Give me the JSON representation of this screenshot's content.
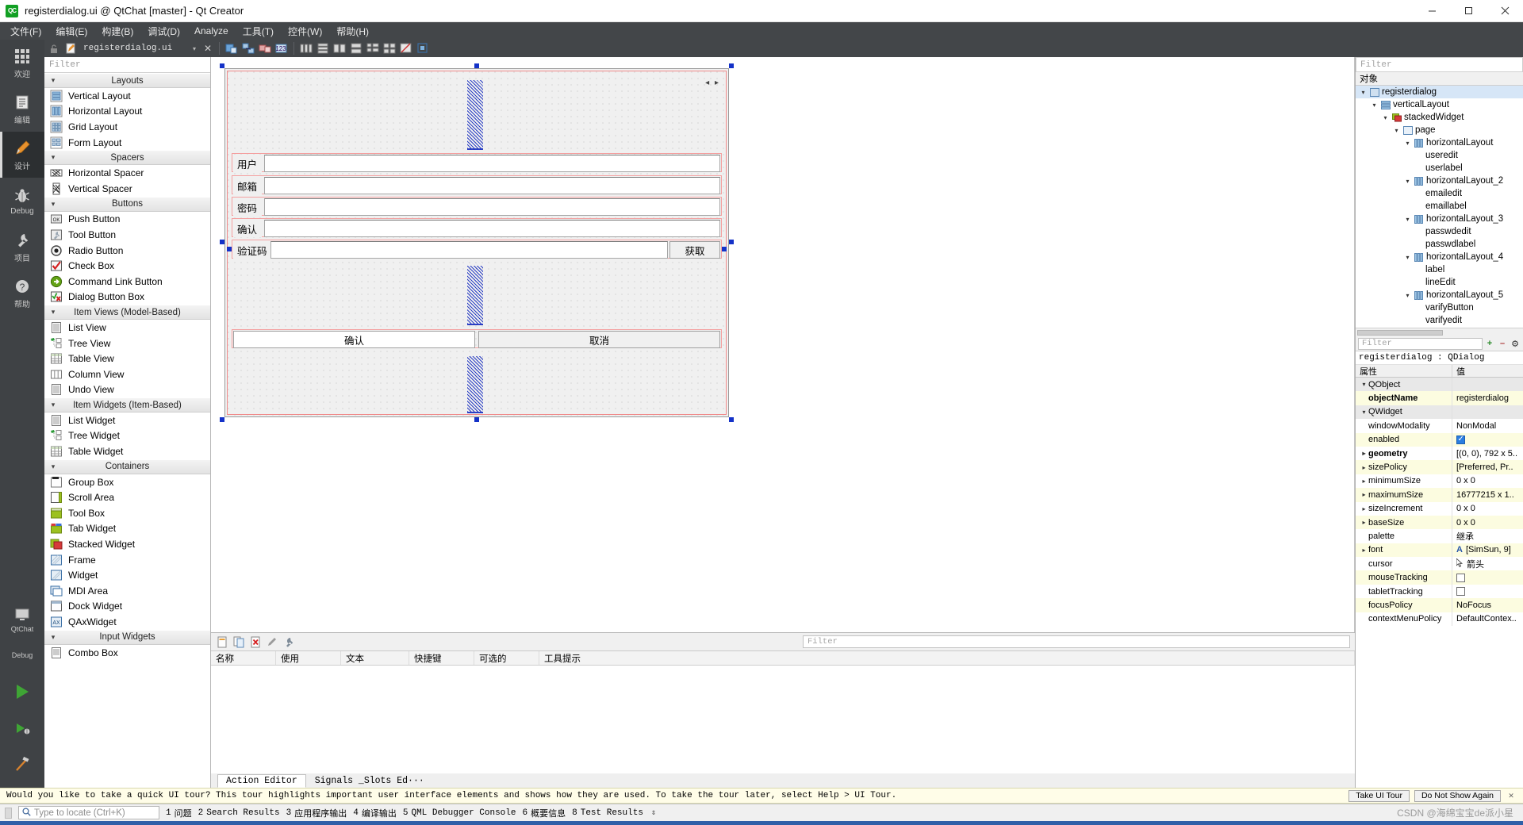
{
  "window": {
    "title": "registerdialog.ui @ QtChat [master] - Qt Creator",
    "app_badge": "QC",
    "minimize": "–",
    "maximize": "□",
    "close": "✕"
  },
  "menubar": [
    {
      "label": "文件(F)",
      "mnemonic": "F"
    },
    {
      "label": "编辑(E)",
      "mnemonic": "E"
    },
    {
      "label": "构建(B)",
      "mnemonic": "B"
    },
    {
      "label": "调试(D)",
      "mnemonic": "D"
    },
    {
      "label": "Analyze",
      "mnemonic": "A"
    },
    {
      "label": "工具(T)",
      "mnemonic": "T"
    },
    {
      "label": "控件(W)",
      "mnemonic": "W"
    },
    {
      "label": "帮助(H)",
      "mnemonic": "H"
    }
  ],
  "modebar": {
    "items": [
      {
        "label": "欢迎",
        "icon": "grid-icon",
        "active": false
      },
      {
        "label": "编辑",
        "icon": "document-icon",
        "active": false
      },
      {
        "label": "设计",
        "icon": "pencil-icon",
        "active": true
      },
      {
        "label": "Debug",
        "icon": "bug-icon",
        "active": false
      },
      {
        "label": "项目",
        "icon": "wrench-icon",
        "active": false
      },
      {
        "label": "帮助",
        "icon": "question-icon",
        "active": false
      }
    ],
    "bottom": [
      {
        "label": "QtChat",
        "icon": "monitor-icon"
      },
      {
        "label": "Debug",
        "icon": "monitor-icon"
      },
      {
        "label": "",
        "icon": "run-icon"
      },
      {
        "label": "",
        "icon": "debug-run-icon"
      },
      {
        "label": "",
        "icon": "build-hammer-icon"
      }
    ]
  },
  "editor_toolbar": {
    "file_name": "registerdialog.ui",
    "caret": "▾",
    "close": "✕",
    "tools": [
      "edit-widgets-icon",
      "edit-signals-icon",
      "edit-buddies-icon",
      "edit-tab-order-icon",
      "layout-horizontal-icon",
      "layout-vertical-icon",
      "layout-splitter-h-icon",
      "layout-splitter-v-icon",
      "layout-form-icon",
      "layout-grid-icon",
      "break-layout-icon",
      "adjust-size-icon"
    ]
  },
  "widget_box": {
    "filter_placeholder": "Filter",
    "groups": [
      {
        "name": "Layouts",
        "items": [
          {
            "label": "Vertical Layout",
            "icon": "vertical-layout-icon"
          },
          {
            "label": "Horizontal Layout",
            "icon": "horizontal-layout-icon"
          },
          {
            "label": "Grid Layout",
            "icon": "grid-layout-icon"
          },
          {
            "label": "Form Layout",
            "icon": "form-layout-icon"
          }
        ]
      },
      {
        "name": "Spacers",
        "items": [
          {
            "label": "Horizontal Spacer",
            "icon": "horizontal-spacer-icon"
          },
          {
            "label": "Vertical Spacer",
            "icon": "vertical-spacer-icon"
          }
        ]
      },
      {
        "name": "Buttons",
        "items": [
          {
            "label": "Push Button",
            "icon": "push-button-icon"
          },
          {
            "label": "Tool Button",
            "icon": "tool-button-icon"
          },
          {
            "label": "Radio Button",
            "icon": "radio-button-icon"
          },
          {
            "label": "Check Box",
            "icon": "check-box-icon"
          },
          {
            "label": "Command Link Button",
            "icon": "command-link-icon"
          },
          {
            "label": "Dialog Button Box",
            "icon": "dialog-button-box-icon"
          }
        ]
      },
      {
        "name": "Item Views (Model-Based)",
        "items": [
          {
            "label": "List View",
            "icon": "list-view-icon"
          },
          {
            "label": "Tree View",
            "icon": "tree-view-icon"
          },
          {
            "label": "Table View",
            "icon": "table-view-icon"
          },
          {
            "label": "Column View",
            "icon": "column-view-icon"
          },
          {
            "label": "Undo View",
            "icon": "undo-view-icon"
          }
        ]
      },
      {
        "name": "Item Widgets (Item-Based)",
        "items": [
          {
            "label": "List Widget",
            "icon": "list-widget-icon"
          },
          {
            "label": "Tree Widget",
            "icon": "tree-widget-icon"
          },
          {
            "label": "Table Widget",
            "icon": "table-widget-icon"
          }
        ]
      },
      {
        "name": "Containers",
        "items": [
          {
            "label": "Group Box",
            "icon": "group-box-icon"
          },
          {
            "label": "Scroll Area",
            "icon": "scroll-area-icon"
          },
          {
            "label": "Tool Box",
            "icon": "tool-box-icon"
          },
          {
            "label": "Tab Widget",
            "icon": "tab-widget-icon"
          },
          {
            "label": "Stacked Widget",
            "icon": "stacked-widget-icon"
          },
          {
            "label": "Frame",
            "icon": "frame-icon"
          },
          {
            "label": "Widget",
            "icon": "widget-icon"
          },
          {
            "label": "MDI Area",
            "icon": "mdi-area-icon"
          },
          {
            "label": "Dock Widget",
            "icon": "dock-widget-icon"
          },
          {
            "label": "QAxWidget",
            "icon": "qax-widget-icon"
          }
        ]
      },
      {
        "name": "Input Widgets",
        "items": [
          {
            "label": "Combo Box",
            "icon": "combo-box-icon"
          }
        ]
      }
    ]
  },
  "designer": {
    "form_rows": [
      {
        "label": "用户",
        "widget": "lineedit"
      },
      {
        "label": "邮箱",
        "widget": "lineedit"
      },
      {
        "label": "密码",
        "widget": "lineedit"
      },
      {
        "label": "确认",
        "widget": "lineedit"
      },
      {
        "label": "验证码",
        "widget": "lineedit",
        "button": "获取"
      }
    ],
    "buttons": [
      {
        "label": "确认"
      },
      {
        "label": "取消"
      }
    ],
    "nav_arrows": "◂ ▸"
  },
  "object_inspector": {
    "filter_placeholder": "Filter",
    "column_header": "对象",
    "rows": [
      {
        "label": "registerdialog",
        "depth": 0,
        "caret": "▾",
        "icon": "widget-icon",
        "selected": true
      },
      {
        "label": "verticalLayout",
        "depth": 1,
        "caret": "▾",
        "icon": "layout-icon",
        "selected": false
      },
      {
        "label": "stackedWidget",
        "depth": 2,
        "caret": "▾",
        "icon": "stacked-icon",
        "selected": false
      },
      {
        "label": "page",
        "depth": 3,
        "caret": "▾",
        "icon": "page-icon",
        "selected": false
      },
      {
        "label": "horizontalLayout",
        "depth": 4,
        "caret": "▾",
        "icon": "layout-icon",
        "selected": false
      },
      {
        "label": "useredit",
        "depth": 5,
        "caret": "",
        "icon": "lineedit-icon",
        "selected": false
      },
      {
        "label": "userlabel",
        "depth": 5,
        "caret": "",
        "icon": "label-icon",
        "selected": false
      },
      {
        "label": "horizontalLayout_2",
        "depth": 4,
        "caret": "▾",
        "icon": "layout-icon",
        "selected": false
      },
      {
        "label": "emailedit",
        "depth": 5,
        "caret": "",
        "icon": "lineedit-icon",
        "selected": false
      },
      {
        "label": "emaillabel",
        "depth": 5,
        "caret": "",
        "icon": "label-icon",
        "selected": false
      },
      {
        "label": "horizontalLayout_3",
        "depth": 4,
        "caret": "▾",
        "icon": "layout-icon",
        "selected": false
      },
      {
        "label": "passwdedit",
        "depth": 5,
        "caret": "",
        "icon": "lineedit-icon",
        "selected": false
      },
      {
        "label": "passwdlabel",
        "depth": 5,
        "caret": "",
        "icon": "label-icon",
        "selected": false
      },
      {
        "label": "horizontalLayout_4",
        "depth": 4,
        "caret": "▾",
        "icon": "layout-icon",
        "selected": false
      },
      {
        "label": "label",
        "depth": 5,
        "caret": "",
        "icon": "label-icon",
        "selected": false
      },
      {
        "label": "lineEdit",
        "depth": 5,
        "caret": "",
        "icon": "lineedit-icon",
        "selected": false
      },
      {
        "label": "horizontalLayout_5",
        "depth": 4,
        "caret": "▾",
        "icon": "layout-icon",
        "selected": false
      },
      {
        "label": "varifyButton",
        "depth": 5,
        "caret": "",
        "icon": "button-icon",
        "selected": false
      },
      {
        "label": "varifyedit",
        "depth": 5,
        "caret": "",
        "icon": "lineedit-icon",
        "selected": false
      }
    ]
  },
  "property_editor": {
    "filter_placeholder": "Filter",
    "add_btn": "+",
    "remove_btn": "–",
    "config_btn": "⚙",
    "object_line": "registerdialog : QDialog",
    "headers": {
      "name": "属性",
      "value": "值"
    },
    "rows": [
      {
        "name": "QObject",
        "value": "",
        "type": "class",
        "caret": "▾"
      },
      {
        "name": "objectName",
        "value": "registerdialog",
        "type": "prop",
        "bold": true,
        "highlight": true
      },
      {
        "name": "QWidget",
        "value": "",
        "type": "class",
        "caret": "▾"
      },
      {
        "name": "windowModality",
        "value": "NonModal",
        "type": "prop"
      },
      {
        "name": "enabled",
        "value": "",
        "type": "checkbox",
        "checked": true,
        "highlight": true
      },
      {
        "name": "geometry",
        "value": "[(0, 0), 792 x 5..",
        "type": "prop",
        "bold": true,
        "caret": "▸"
      },
      {
        "name": "sizePolicy",
        "value": "[Preferred, Pr..",
        "type": "prop",
        "caret": "▸",
        "highlight": true
      },
      {
        "name": "minimumSize",
        "value": "0 x 0",
        "type": "prop",
        "caret": "▸"
      },
      {
        "name": "maximumSize",
        "value": "16777215 x 1..",
        "type": "prop",
        "caret": "▸",
        "highlight": true
      },
      {
        "name": "sizeIncrement",
        "value": "0 x 0",
        "type": "prop",
        "caret": "▸"
      },
      {
        "name": "baseSize",
        "value": "0 x 0",
        "type": "prop",
        "caret": "▸",
        "highlight": true
      },
      {
        "name": "palette",
        "value": "继承",
        "type": "prop"
      },
      {
        "name": "font",
        "value": "[SimSun, 9]",
        "type": "font",
        "caret": "▸",
        "highlight": true
      },
      {
        "name": "cursor",
        "value": "箭头",
        "type": "cursor"
      },
      {
        "name": "mouseTracking",
        "value": "",
        "type": "checkbox",
        "checked": false,
        "highlight": true
      },
      {
        "name": "tabletTracking",
        "value": "",
        "type": "checkbox",
        "checked": false
      },
      {
        "name": "focusPolicy",
        "value": "NoFocus",
        "type": "prop",
        "highlight": true
      },
      {
        "name": "contextMenuPolicy",
        "value": "DefaultContex..",
        "type": "prop"
      }
    ]
  },
  "action_editor": {
    "toolbar_icons": [
      "new-action-icon",
      "copy-action-icon",
      "delete-action-icon",
      "edit-action-icon",
      "settings-icon"
    ],
    "filter_placeholder": "Filter",
    "columns": [
      "名称",
      "使用",
      "文本",
      "快捷键",
      "可选的",
      "工具提示"
    ],
    "tabs": [
      {
        "label": "Action Editor",
        "active": true
      },
      {
        "label": "Signals _Slots Ed···",
        "active": false
      }
    ]
  },
  "tour_banner": {
    "message": "Would you like to take a quick UI tour? This tour highlights important user interface elements and shows how they are used. To take the tour later, select Help > UI Tour.",
    "primary_button": "Take UI Tour",
    "secondary_button": "Do Not Show Again",
    "close": "✕"
  },
  "statusbar": {
    "locator_placeholder": "Type to locate (Ctrl+K)",
    "items": [
      {
        "num": "1",
        "label": "问题"
      },
      {
        "num": "2",
        "label": "Search Results"
      },
      {
        "num": "3",
        "label": "应用程序输出"
      },
      {
        "num": "4",
        "label": "编译输出"
      },
      {
        "num": "5",
        "label": "QML Debugger Console"
      },
      {
        "num": "6",
        "label": "概要信息"
      },
      {
        "num": "8",
        "label": "Test Results"
      }
    ],
    "updown": "⇕",
    "watermark": "CSDN @海绵宝宝de派小星"
  }
}
